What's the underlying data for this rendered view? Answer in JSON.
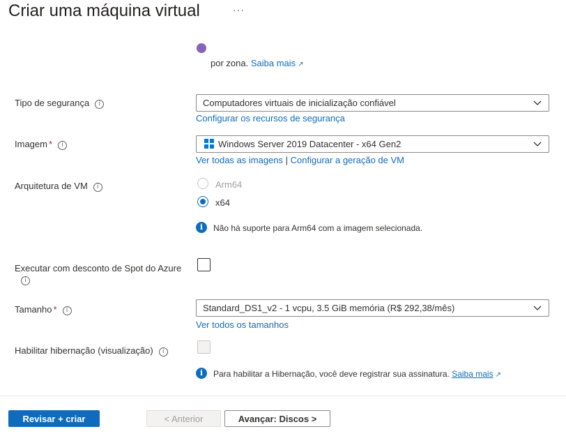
{
  "header": {
    "title": "Criar uma máquina virtual",
    "more": "···"
  },
  "availability": {
    "text_line": "por zona.",
    "link": "Saiba mais"
  },
  "security": {
    "label": "Tipo de segurança",
    "value": "Computadores virtuais de inicialização confiável",
    "link": "Configurar os recursos de segurança"
  },
  "image": {
    "label": "Imagem",
    "required": "*",
    "value": "Windows Server 2019 Datacenter - x64 Gen2",
    "link_all": "Ver todas as imagens",
    "separator": "|",
    "link_config": "Configurar a geração de VM"
  },
  "architecture": {
    "label": "Arquitetura de VM",
    "options": [
      "Arm64",
      "x64"
    ],
    "selected": "x64",
    "note": "Não há suporte para Arm64 com a imagem selecionada."
  },
  "spot": {
    "label": "Executar com desconto de Spot do Azure",
    "checked": false
  },
  "size": {
    "label": "Tamanho",
    "required": "*",
    "value": "Standard_DS1_v2 - 1 vcpu, 3.5 GiB memória (R$ 292,38/mês)",
    "link": "Ver todos os tamanhos"
  },
  "hibernation": {
    "label": "Habilitar hibernação (visualização)",
    "checked": false,
    "note": "Para habilitar a Hibernação, você deve registrar sua assinatura.",
    "link": "Saiba mais"
  },
  "footer": {
    "review_create": "Revisar + criar",
    "previous": "< Anterior",
    "next": "Avançar: Discos >"
  },
  "colors": {
    "accent": "#0f6cbd",
    "required": "#a4262c",
    "text": "#323130"
  }
}
